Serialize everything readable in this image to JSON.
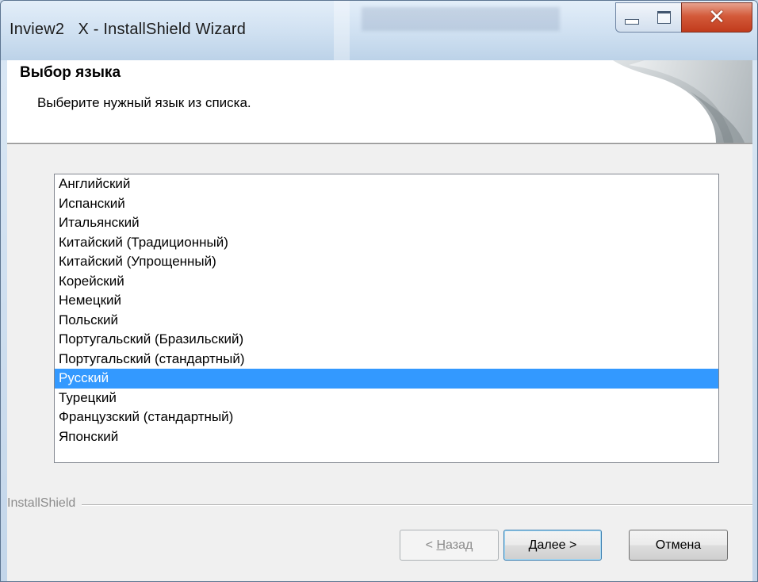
{
  "window": {
    "title": "Inview2   X - InstallShield Wizard",
    "controls": [
      "minimize",
      "maximize",
      "close"
    ]
  },
  "header": {
    "title": "Выбор языка",
    "subtitle": "Выберите нужный язык из списка."
  },
  "language_list": {
    "items": [
      "Английский",
      "Испанский",
      "Итальянский",
      "Китайский (Традиционный)",
      "Китайский (Упрощенный)",
      "Корейский",
      "Немецкий",
      "Польский",
      "Португальский (Бразильский)",
      "Португальский (стандартный)",
      "Русский",
      "Турецкий",
      "Французский (стандартный)",
      "Японский"
    ],
    "selected": "Русский"
  },
  "footer": {
    "brand": "InstallShield",
    "back_prefix": "< ",
    "back_key": "Н",
    "back_rest": "азад",
    "next_label": "Далее >",
    "cancel_label": "Отмена"
  },
  "colors": {
    "selection": "#3399ff",
    "close_button": "#c13b1c"
  }
}
